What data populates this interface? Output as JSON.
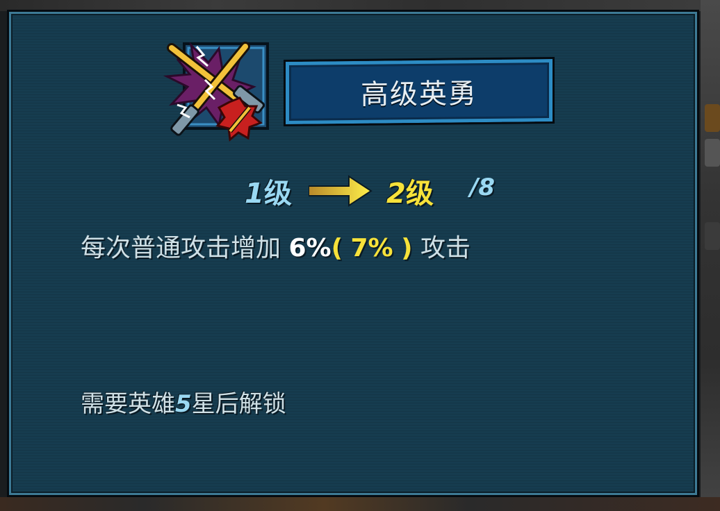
{
  "skill": {
    "title": "高级英勇",
    "icon": "crossed-swords-lightning-icon"
  },
  "level": {
    "current_num": "1",
    "current_unit": "级",
    "next_num": "2",
    "next_unit": "级",
    "max": "/8"
  },
  "description": {
    "prefix": "每次普通攻击增加",
    "current_value": "6%",
    "next_open": "(",
    "next_value": "7%",
    "next_close": ")",
    "suffix": "攻击"
  },
  "unlock": {
    "prefix": "需要英雄",
    "stars": "5",
    "suffix": "星后解锁"
  },
  "colors": {
    "panel": "#163c4f",
    "title_box": "#0d3d6a",
    "current_level": "#9ad8f2",
    "next_level": "#f7e23a"
  }
}
